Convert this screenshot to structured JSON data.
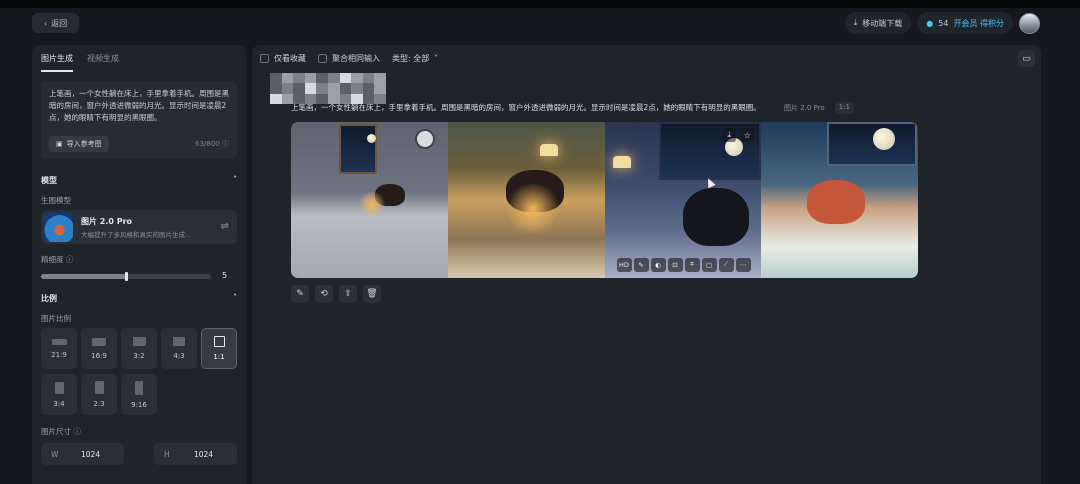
{
  "header": {
    "back_label": "返回",
    "download_label": "移动端下载",
    "points": "54",
    "vip_label": "开会员 得积分"
  },
  "left": {
    "tabs": [
      "图片生成",
      "视频生成"
    ],
    "prompt": "上笔画，一个女性躺在床上，手里拿着手机。周围是黑暗的房间，窗户外透进微弱的月光。显示时间是凌晨2点，她的眼睛下有明显的黑眼圈。",
    "import_label": "导入参考图",
    "counter": "63/800",
    "model_section": "模型",
    "model_sub": "生图模型",
    "model_name": "图片 2.0 Pro",
    "model_desc": "大幅提升了多风格和真实的图片生成...",
    "fine_label": "精细度",
    "fine_value": "5",
    "fine_fraction": 0.5,
    "ratio_section": "比例",
    "ratio_sub": "图片比例",
    "ratios": [
      "21:9",
      "16:9",
      "3:2",
      "4:3",
      "1:1",
      "3:4",
      "2:3",
      "9:16"
    ],
    "selected_ratio": "1:1",
    "size_label": "图片尺寸",
    "width_key": "W",
    "width_value": "1024",
    "height_key": "H",
    "height_value": "1024"
  },
  "main": {
    "filter_favorites": "仅看收藏",
    "filter_aggregate": "聚合相同输入",
    "filter_type": "类型: 全部",
    "gen_prompt": "上笔画，一个女性躺在床上，手里拿着手机。周围是黑暗的房间，窗户外透进微弱的月光。显示时间是凌晨2点，她的眼睛下有明显的黑眼圈。",
    "gen_model": "图片 2.0 Pro",
    "gen_ratio": "1:1",
    "toolbar_hd": "HD"
  },
  "colors": {
    "background": "#15171c",
    "panel": "#1f232a",
    "accent": "#4fc3f7"
  }
}
